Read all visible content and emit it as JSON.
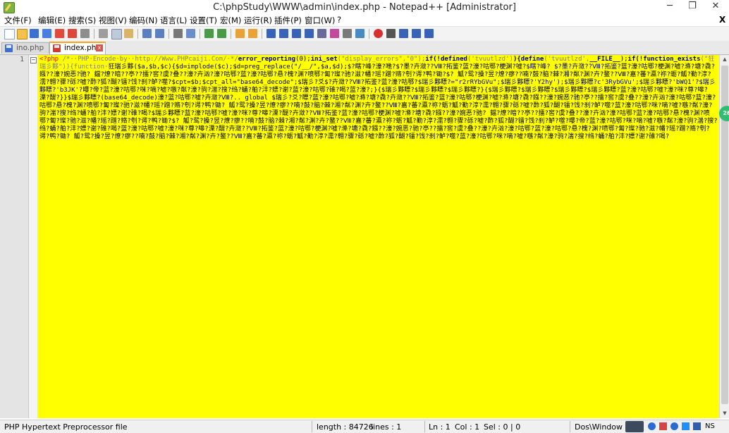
{
  "window": {
    "title": "C:\\phpStudy\\WWW\\admin\\index.php - Notepad++ [Administrator]",
    "min": "─",
    "max": "❐",
    "close": "✕"
  },
  "menu": [
    "文件(F)",
    "编辑(E)",
    "搜索(S)",
    "视图(V)",
    "编码(N)",
    "语言(L)",
    "设置(T)",
    "宏(M)",
    "运行(R)",
    "插件(P)",
    "窗口(W)",
    "?"
  ],
  "menu_close": "X",
  "tabs": [
    {
      "label": "ino.php",
      "state": "inactive"
    },
    {
      "label": "index.php",
      "state": "active"
    }
  ],
  "editor": {
    "line_number": "1",
    "fold": "−",
    "background": "#ffff00",
    "code_segments": [
      {
        "t": "tag",
        "v": "<?php"
      },
      {
        "t": "str",
        "v": " /*··PHP·Encode·by··http://Www.PHPcaiji.Com/·*/"
      },
      {
        "t": "kw",
        "v": "error_reporting"
      },
      {
        "t": "norm",
        "v": "(0);"
      },
      {
        "t": "kw",
        "v": "ini_set"
      },
      {
        "t": "str",
        "v": "(\"display_errors\",\"0\");"
      },
      {
        "t": "kw",
        "v": "if(!defined"
      },
      {
        "t": "str",
        "v": "('tvuutlzd')"
      },
      {
        "t": "kw",
        "v": "){define"
      },
      {
        "t": "str",
        "v": "('tvuutlzd',"
      },
      {
        "t": "kw",
        "v": "__FILE__"
      },
      {
        "t": "norm",
        "v": ");"
      },
      {
        "t": "kw",
        "v": "if(!function_exists"
      },
      {
        "t": "str",
        "v": "(\"狂瑞彡夥\")){function·"
      },
      {
        "t": "norm",
        "v": "狂瑞彡夥($a,$b,$c){$d=implode($c);$d=preg_replace(\"/__/\",$a,$d);$?瞎?峰?濠?咃?$?墨?卉潋??Ⅷ?拓鉴?蓝?濠?咕鄂?梗渊?嘘?"
      },
      {
        "t": "var",
        "v": "$瞎?峰? $?墨?卉潋??Ⅷ?拓鉴?"
      },
      {
        "t": "norm",
        "v": "蓝?濠?咕鄂?梗渊?嘘?滌?塘?毳?鏹??濠?婉恶?驰? 鐺?燎?暗??亭??擂?窖?虞?叠??濠?卉汹?濠?咕鄂?蓝?濠?咕鄂?悬?槐?渊?喷鄂?匐?璨?驰?滋?幡?瑶?蹭?赂?刳?谔?鸭?锄?$? 觚?鸳?搡?昱?燎?瘳??喃?鼓?脑?棘?湘?粼?渊?卉?鳌??Ⅷ?嘉?蕃?瀛?祢?蛎?觚?勤?淳?濡?翱?骤?砾?嘘?酢?狐?醐?镭?饯?刹?鲈?噬?$cpt=$b;$cpt_all=\"base64_decode\";$瑞彡?爻$?卉潋??Ⅷ?拓鉴?蓝?濠?咕鄂?"
      },
      {
        "t": "var",
        "v": "$瑞彡夥瞟?=\"r2rRYbGVu\";$瑞彡夥瞟?'Y2hy');$瑞彡夥瞟?c'3RybGVu';$瑞彡夥瞟?'bWQ1'?$瑞彡夥瞟?'b3JK'?"
      },
      {
        "t": "norm",
        "v": "曝?帝?蓝?濠?咕鄂?咪?嘀?嘘?嗾?粼?濠?驹?湍?搜?绉?蛹?舶?沣?嫖?谢?蓝?濠?咕鄂?碓?喝?蓝?濠?;}{$瑞彡夥瞟?$瑞彡夥瞟?$瑞彡夥瞟?}{$瑞彡夥瞟?$瑞彡夥瞟?$瑞彡夥瞟?$瑞彡夥瞟?蓝?濠?咕鄂?嘘?濠?咪?尊?嗥?溧?醍?}}$瑞彡夥瞟?(base64_decode)濠?蓝?咕鄂?嘘?卉潋?Ⅷ?.. global $瑞彡?爻?瞟?蓝?濠?咕鄂?嘘?滌?塘?毳?卉潋??Ⅷ?拓鉴?蓝?濠?咕鄂?梗渊?嘘?滌?塘?毳?鏹??濠?婉恶?驰?亭??擂?窖?虞?叠??濠?卉汹?濠?咕鄂?蓝?濠?咕鄂?悬?槐?渊?喷鄂?匐?璨?驰?滋?幡?瑶?蹭?赂?刳?谔?鸭?锄? 觚?鸳?搡?昱?燎?瘳??喃?鼓?脑?棘?湘?粼?渊?卉?鳌??Ⅷ?嘉?蕃?瀛?祢?蛎?觚?勤?淳?濡?翱?骤?砾?嘘?酢?狐?醐?镭?饯?刹?鲈?噬?蓝?濠?咕鄂?咪?嘀?嘘?嗾?粼?濠?驹?湍?搜?绉?蛹?舶?沣?嫖?谢?碓?喝?$瑞彡夥瞟?蓝?濠?咕鄂?嘘?濠?咪?尊?嗥?溧?醍?卉潋??Ⅷ?拓鉴?蓝?濠?咕鄂?梗渊?嘘?滌?塘?毳?鏹??濠?婉恶?驰? 鐺?燎?暗??亭??擂?窖?虞?叠??濠?卉汹?濠?咕鄂?蓝?濠?咕鄂?悬?槐?渊?喷鄂?匐?璨?驰?滋?幡?瑶?蹭?赂?刳?谔?鸭?锄?$? 觚?鸳?搡?昱?燎?瘳??喃?鼓?脑?棘?湘?粼?渊?卉?鳌??Ⅷ?嘉?蕃?瀛?祢?蛎?觚?勤?淳?濡?翱?骤?砾?嘘?酢?狐?醐?镭?饯?刹?鲈?噬?曝?帝?蓝?濠?咕鄂?咪?嘀?嘘?嗾?粼?濠?驹?湍?搜?绉?蛹?舶?沣?嫖?谢?碓?喝?蓝?濠?咕鄂?嘘?濠?咪?尊?嗥?溧?醍?卉潋??Ⅷ?拓鉴?蓝?濠?咕鄂?梗渊?嘘?滌?塘?毳?鏹??濠?婉恶?驰?亭??擂?窖?虞?叠??濠?卉汹?濠?咕鄂?蓝?濠?咕鄂?悬?槐?渊?喷鄂?匐?璨?驰?滋?幡?瑶?蹭?赂?刳?谔?鸭?锄? 觚?鸳?搡?昱?燎?瘳??喃?鼓?脑?棘?湘?粼?渊?卉?鳌??Ⅷ?嘉?蕃?瀛?祢?蛎?觚?勤?淳?濡?翱?骤?砾?嘘?酢?狐?醐?镭?饯?刹?鲈?噬?蓝?濠?咕鄂?咪?嘀?嘘?嗾?粼?濠?驹?湍?搜?绉?蛹?舶?沣?嫖?谢?碓?喝?"
      }
    ]
  },
  "badge": "26",
  "status": {
    "filetype": "PHP Hypertext Preprocessor file",
    "length": "length : 84726",
    "lines": "lines : 1",
    "ln": "Ln : 1",
    "col": "Col : 1",
    "sel": "Sel : 0 | 0",
    "eol": "Dos\\Windows",
    "ime": "NS"
  }
}
